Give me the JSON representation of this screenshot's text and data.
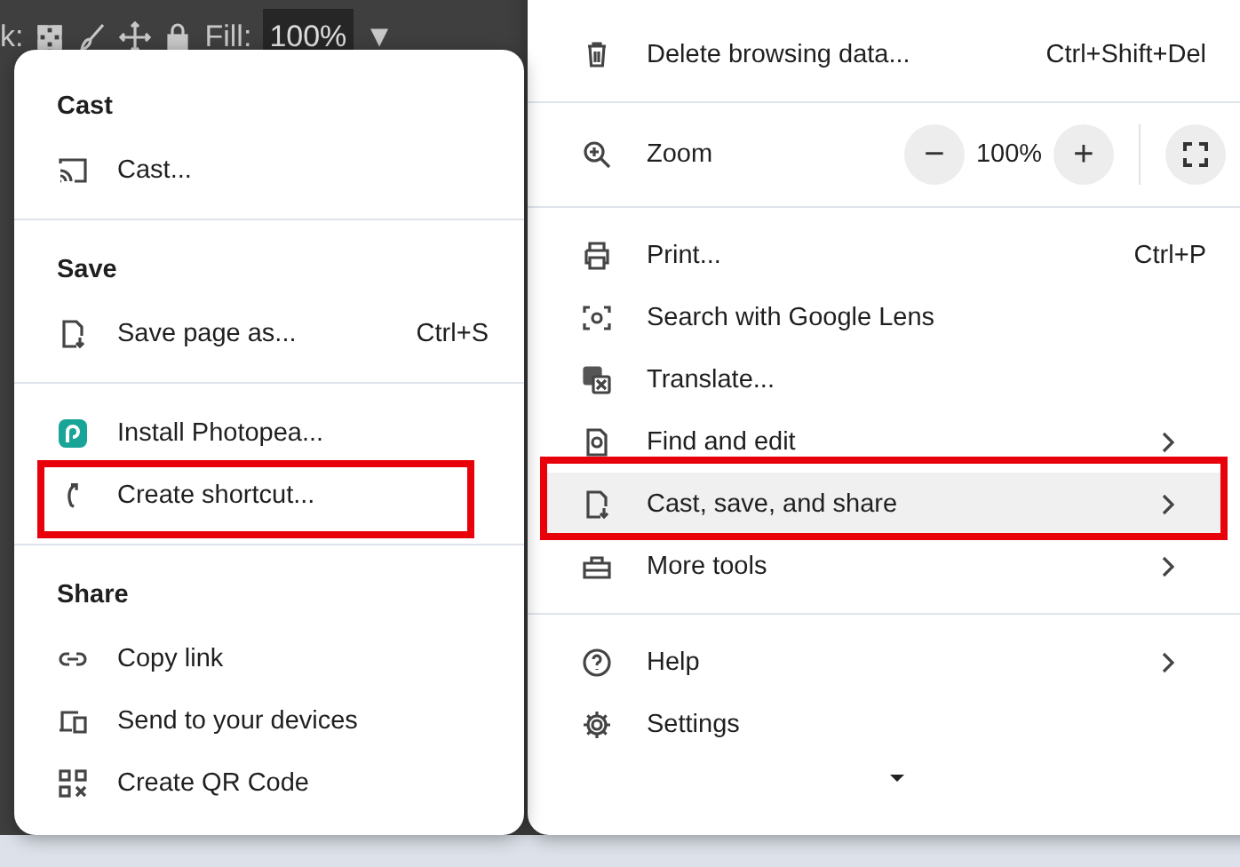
{
  "toolbar": {
    "label": "k:",
    "fill_label": "Fill:",
    "fill_value": "100%",
    "dropdown": "▼"
  },
  "main_menu": {
    "sections": [
      {
        "items": [
          {
            "kind": "item",
            "label": "Delete browsing data...",
            "shortcut": "Ctrl+Shift+Del",
            "submenu": false,
            "selected": false
          }
        ]
      },
      {
        "items": [
          {
            "kind": "zoom",
            "label": "Zoom",
            "minus": "−",
            "value": "100%",
            "plus": "+"
          }
        ]
      },
      {
        "items": [
          {
            "kind": "item",
            "label": "Print...",
            "shortcut": "Ctrl+P",
            "submenu": false,
            "selected": false
          },
          {
            "kind": "item",
            "label": "Search with Google Lens",
            "submenu": false,
            "selected": false
          },
          {
            "kind": "item",
            "label": "Translate...",
            "submenu": false,
            "selected": false
          },
          {
            "kind": "item",
            "label": "Find and edit",
            "submenu": true,
            "selected": false
          },
          {
            "kind": "item",
            "label": "Cast, save, and share",
            "submenu": true,
            "selected": true
          },
          {
            "kind": "item",
            "label": "More tools",
            "submenu": true,
            "selected": false
          }
        ]
      },
      {
        "items": [
          {
            "kind": "item",
            "label": "Help",
            "submenu": true,
            "selected": false
          },
          {
            "kind": "item",
            "label": "Settings",
            "submenu": false,
            "selected": false
          }
        ]
      }
    ]
  },
  "submenu": {
    "sections": [
      {
        "heading": "Cast",
        "items": [
          {
            "label": "Cast..."
          }
        ]
      },
      {
        "heading": "Save",
        "items": [
          {
            "label": "Save page as...",
            "shortcut": "Ctrl+S"
          }
        ]
      },
      {
        "items": [
          {
            "label": "Install Photopea..."
          },
          {
            "label": "Create shortcut..."
          }
        ]
      },
      {
        "heading": "Share",
        "items": [
          {
            "label": "Copy link"
          },
          {
            "label": "Send to your devices"
          },
          {
            "label": "Create QR Code"
          }
        ]
      }
    ]
  }
}
